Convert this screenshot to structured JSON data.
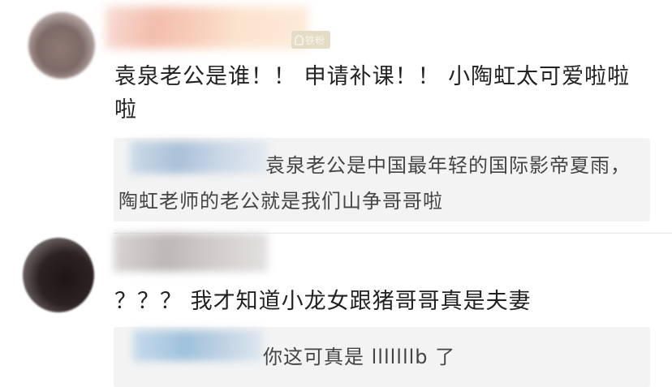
{
  "comments": [
    {
      "badge": "铁粉",
      "text": "袁泉老公是谁！！ 申请补课！！ 小陶虹太可爱啦啦啦",
      "reply": "袁泉老公是中国最年轻的国际影帝夏雨，陶虹老师的老公就是我们山争哥哥啦"
    },
    {
      "text": "？？？ 我才知道小龙女跟猪哥哥真是夫妻",
      "reply": "你这可真是 lllllllb 了"
    }
  ],
  "icons": {
    "badge_icon": "fan-badge-icon"
  },
  "colors": {
    "text": "#222222",
    "reply_text": "#444444",
    "reply_background": "#f3f3f3",
    "badge_background": "#e5dcc5"
  }
}
